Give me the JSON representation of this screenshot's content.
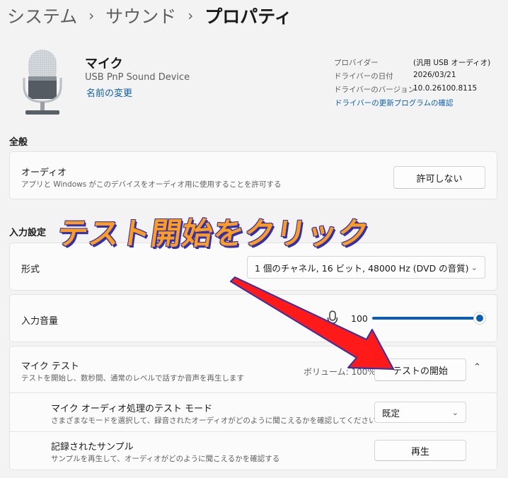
{
  "breadcrumb": {
    "items": [
      "システム",
      "サウンド"
    ],
    "current": "プロパティ",
    "separator": "›"
  },
  "device": {
    "name": "マイク",
    "subtitle": "USB PnP Sound Device",
    "rename_link": "名前の変更",
    "icon": "microphone-icon"
  },
  "driver_info": {
    "provider_label": "プロバイダー",
    "provider_value": "(汎用 USB オーディオ)",
    "date_label": "ドライバーの日付",
    "date_value": "2026/03/21",
    "version_label": "ドライバーのバージョン",
    "version_value": "10.0.26100.8115",
    "update_link": "ドライバーの更新プログラムの確認"
  },
  "general": {
    "heading": "全般",
    "audio": {
      "title": "オーディオ",
      "description": "アプリと Windows がこのデバイスをオーディオ用に使用することを許可する",
      "button": "許可しない"
    }
  },
  "input_settings": {
    "heading": "入力設定",
    "format": {
      "title": "形式",
      "value": "1 個のチャネル, 16 ビット, 48000 Hz (DVD の音質)",
      "chevron": "chevron-down-icon"
    },
    "input_volume": {
      "title": "入力音量",
      "value": "100",
      "level_percent": 100,
      "icon": "microphone-icon"
    },
    "mic_test": {
      "title": "マイク テスト",
      "description": "テストを開始し、数秒間、通常のレベルで話すか音声を再生します",
      "volume_label": "ボリューム: 100%",
      "button": "テストの開始",
      "chevron": "chevron-up-icon"
    },
    "test_mode": {
      "title": "マイク オーディオ処理のテスト モード",
      "description": "さまざまなモードを選択して、録音されたオーディオがどのように聞こえるかを確認してください",
      "value": "既定"
    },
    "recorded_sample": {
      "title": "記録されたサンプル",
      "description": "サンプルを再生して、オーディオがどのように聞こえるかを確認する",
      "button": "再生"
    }
  },
  "annotation": {
    "text": "テスト開始をクリック",
    "text_color": "#ff9c1a",
    "outline_color": "#2f2fb8",
    "arrow_color": "#ff1a1a"
  },
  "colors": {
    "accent": "#0a5fb4",
    "background": "#f3f3f3",
    "card": "#fbfbfb"
  }
}
